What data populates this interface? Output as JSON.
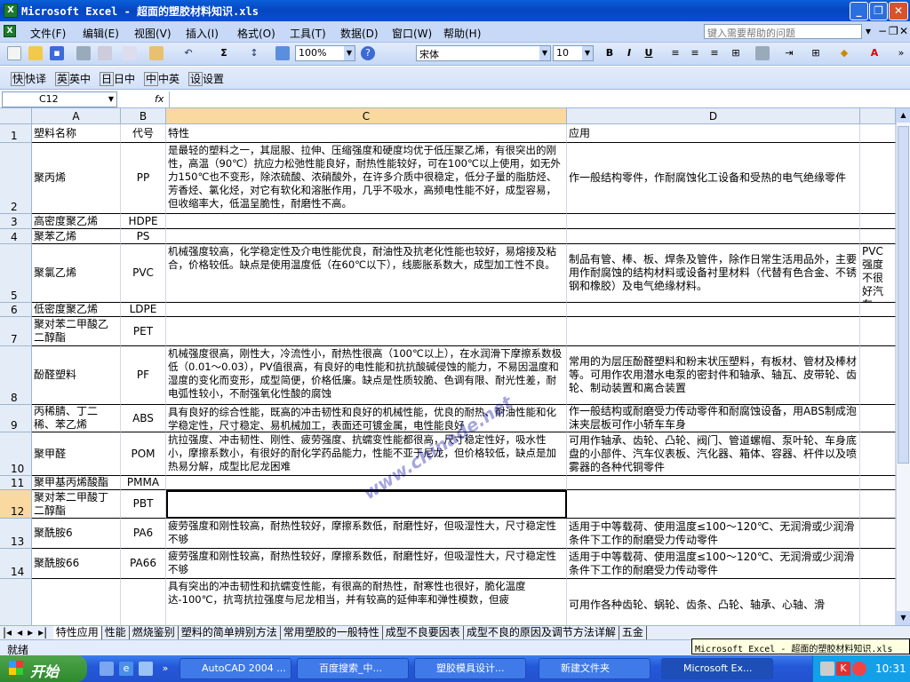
{
  "window": {
    "title": "Microsoft Excel - 超面的塑胶材料知识.xls"
  },
  "menu": {
    "items": [
      "文件(F)",
      "编辑(E)",
      "视图(V)",
      "插入(I)",
      "格式(O)",
      "工具(T)",
      "数据(D)",
      "窗口(W)",
      "帮助(H)"
    ],
    "help_placeholder": "键入需要帮助的问题"
  },
  "toolbar": {
    "zoom": "100%",
    "font": "宋体",
    "size": "10"
  },
  "toolbar2": {
    "items": [
      "快译",
      "英中",
      "日中",
      "中英",
      "设置"
    ]
  },
  "namebox": "C12",
  "fx": "fx",
  "columns": [
    "A",
    "B",
    "C",
    "D"
  ],
  "rows": [
    {
      "n": "1",
      "a": "塑料名称",
      "b": "代号",
      "c": "特性",
      "d": "应用",
      "e": ""
    },
    {
      "n": "2",
      "a": "聚丙烯",
      "b": "PP",
      "c": "是最轻的塑料之一，其屈服、拉伸、压缩强度和硬度均优于低压聚乙烯，有很突出的刚性，高温（90℃）抗应力松弛性能良好，耐热性能较好，可在100℃以上使用，如无外力150℃也不变形，除浓硫酸、浓硝酸外，在许多介质中很稳定，低分子量的脂肪烃、芳香烃、氯化烃，对它有软化和溶胀作用，几乎不吸水，高频电性能不好，成型容易，但收缩率大，低温呈脆性，耐磨性不高。",
      "d": "作一般结构零件，作耐腐蚀化工设备和受热的电气绝缘零件",
      "e": ""
    },
    {
      "n": "3",
      "a": "高密度聚乙烯",
      "b": "HDPE",
      "c": "",
      "d": "",
      "e": ""
    },
    {
      "n": "4",
      "a": "聚苯乙烯",
      "b": "PS",
      "c": "",
      "d": "",
      "e": ""
    },
    {
      "n": "5",
      "a": "聚氯乙烯",
      "b": "PVC",
      "c": "机械强度较高，化学稳定性及介电性能优良，耐油性及抗老化性能也较好，易熔接及粘合，价格较低。缺点是使用温度低（在60℃以下），线膨胀系数大，成型加工性不良。",
      "d": "制品有管、棒、板、焊条及管件，除作日常生活用品外，主要用作耐腐蚀的结构材料或设备衬里材料（代替有色合金、不锈钢和橡胶）及电气绝缘材料。",
      "e": "PVC强度不很好汽车零、桌巾"
    },
    {
      "n": "6",
      "a": "低密度聚乙烯",
      "b": "LDPE",
      "c": "",
      "d": "",
      "e": ""
    },
    {
      "n": "7",
      "a": "聚对苯二甲酸乙二醇酯",
      "b": "PET",
      "c": "",
      "d": "",
      "e": ""
    },
    {
      "n": "8",
      "a": "酚醛塑料",
      "b": "PF",
      "c": "机械强度很高，刚性大，冷流性小，耐热性很高（100℃以上），在水润滑下摩擦系数极低（0.01～0.03），PV值很高，有良好的电性能和抗抗酸碱侵蚀的能力，不易因温度和湿度的变化而变形，成型简便，价格低廉。缺点是性质较脆、色调有限、耐光性差，耐电弧性较小，不耐强氧化性酸的腐蚀",
      "d": "常用的为层压酚醛塑料和粉末状压塑料，有板材、管材及棒材等。可用作农用潜水电泵的密封件和轴承、轴瓦、皮带轮、齿轮、制动装置和离合装置",
      "e": ""
    },
    {
      "n": "9",
      "a": "丙稀腈、丁二稀、苯乙烯",
      "b": "ABS",
      "c": "具有良好的综合性能，既高的冲击韧性和良好的机械性能，优良的耐热、耐油性能和化学稳定性，尺寸稳定、易机械加工，表面还可镀金属，电性能良好",
      "d": "作一般结构或耐磨受力传动零件和耐腐蚀设备，用ABS制成泡沫夹层板可作小轿车车身",
      "e": ""
    },
    {
      "n": "10",
      "a": "聚甲醛",
      "b": "POM",
      "c": "抗拉强度、冲击韧性、刚性、疲劳强度、抗蠕变性能都很高，尺寸稳定性好，吸水性小，摩擦系数小，有很好的耐化学药品能力，性能不亚于尼龙，但价格较低，缺点是加热易分解，成型比尼龙困难",
      "d": "可用作轴承、齿轮、凸轮、阀门、管道螺帽、泵叶轮、车身底盘的小部件、汽车仪表板、汽化器、箱体、容器、杆件以及喷雾器的各种代铜零件",
      "e": ""
    },
    {
      "n": "11",
      "a": "聚甲基丙烯酸酯",
      "b": "PMMA",
      "c": "",
      "d": "",
      "e": ""
    },
    {
      "n": "12",
      "a": "聚对苯二甲酸丁二醇酯",
      "b": "PBT",
      "c": "",
      "d": "",
      "e": ""
    },
    {
      "n": "13",
      "a": "聚酰胺6",
      "b": "PA6",
      "c": "疲劳强度和刚性较高，耐热性较好，摩擦系数低，耐磨性好，但吸湿性大，尺寸稳定性不够",
      "d": "适用于中等载荷、使用温度≤100～120℃、无润滑或少润滑条件下工作的耐磨受力传动零件",
      "e": ""
    },
    {
      "n": "14",
      "a": "聚酰胺66",
      "b": "PA66",
      "c": "疲劳强度和刚性较高，耐热性较好，摩擦系数低，耐磨性好，但吸湿性大，尺寸稳定性不够",
      "d": "适用于中等载荷、使用温度≤100～120℃、无润滑或少润滑条件下工作的耐磨受力传动零件",
      "e": ""
    },
    {
      "n": "",
      "a": "",
      "b": "",
      "c": "具有突出的冲击韧性和抗蠕变性能，有很高的耐热性，耐寒性也很好，脆化温度达-100℃，抗弯抗拉强度与尼龙相当，并有较高的延伸率和弹性模数，但疲",
      "d": "可用作各种齿轮、蜗轮、齿条、凸轮、轴承、心轴、滑",
      "e": ""
    }
  ],
  "watermark": "www.chinade.net",
  "sheets": [
    "特性应用",
    "性能",
    "燃烧鉴别",
    "塑料的简单辨别方法",
    "常用塑胶的一般特性",
    "成型不良要因表",
    "成型不良的原因及调节方法详解",
    "五金"
  ],
  "status": "就绪",
  "tooltip": "Microsoft Excel - 超面的塑胶材料知识.xls",
  "taskbar": {
    "start": "开始",
    "tasks": [
      "AutoCAD 2004 ...",
      "百度搜索_中...",
      "塑胶模具设计...",
      "新建文件夹",
      "Microsoft Ex..."
    ],
    "clock": "10:31"
  }
}
